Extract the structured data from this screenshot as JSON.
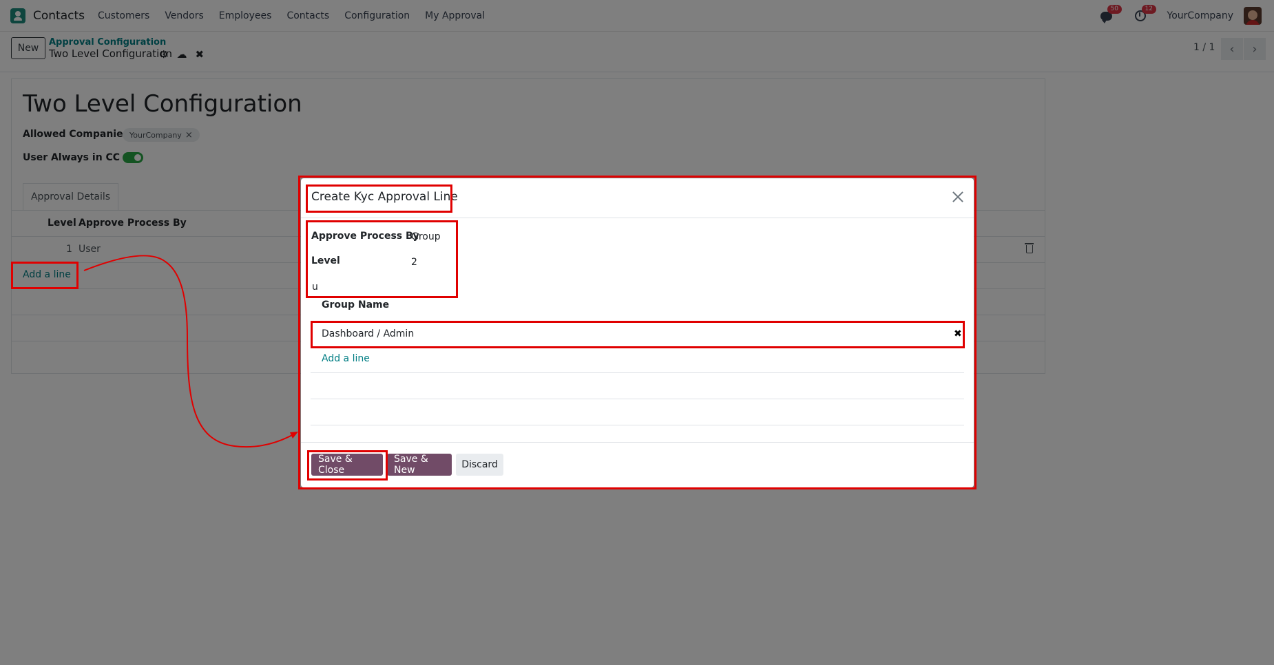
{
  "navbar": {
    "app_name": "Contacts",
    "menu": [
      "Customers",
      "Vendors",
      "Employees",
      "Contacts",
      "Configuration",
      "My Approval"
    ],
    "messages_badge": "50",
    "activities_badge": "12",
    "company": "YourCompany"
  },
  "control_panel": {
    "new_label": "New",
    "breadcrumb": "Approval Configuration",
    "record_title": "Two Level Configuration",
    "pager": "1 / 1"
  },
  "form": {
    "title": "Two Level Configuration",
    "allowed_companies_label": "Allowed Companies",
    "allowed_company_tag": "YourCompany",
    "user_cc_label": "User Always in CC",
    "user_cc_enabled": true,
    "tab_label": "Approval Details",
    "columns": [
      "Level",
      "Approve Process By"
    ],
    "rows": [
      {
        "level": "1",
        "approve_by": "User"
      }
    ],
    "add_line_label": "Add a line"
  },
  "modal": {
    "title": "Create Kyc Approval Line",
    "approve_process_by_label": "Approve Process By",
    "approve_process_by_value": "Group",
    "level_label": "Level",
    "level_value": "2",
    "stray_text": "u",
    "group_name_header": "Group Name",
    "group_rows": [
      "Dashboard / Admin"
    ],
    "add_line_label": "Add a line",
    "buttons": {
      "save_close": "Save & Close",
      "save_new": "Save & New",
      "discard": "Discard"
    }
  },
  "colors": {
    "primary": "#714b67",
    "link": "#017e84",
    "annotation": "#e00000"
  }
}
